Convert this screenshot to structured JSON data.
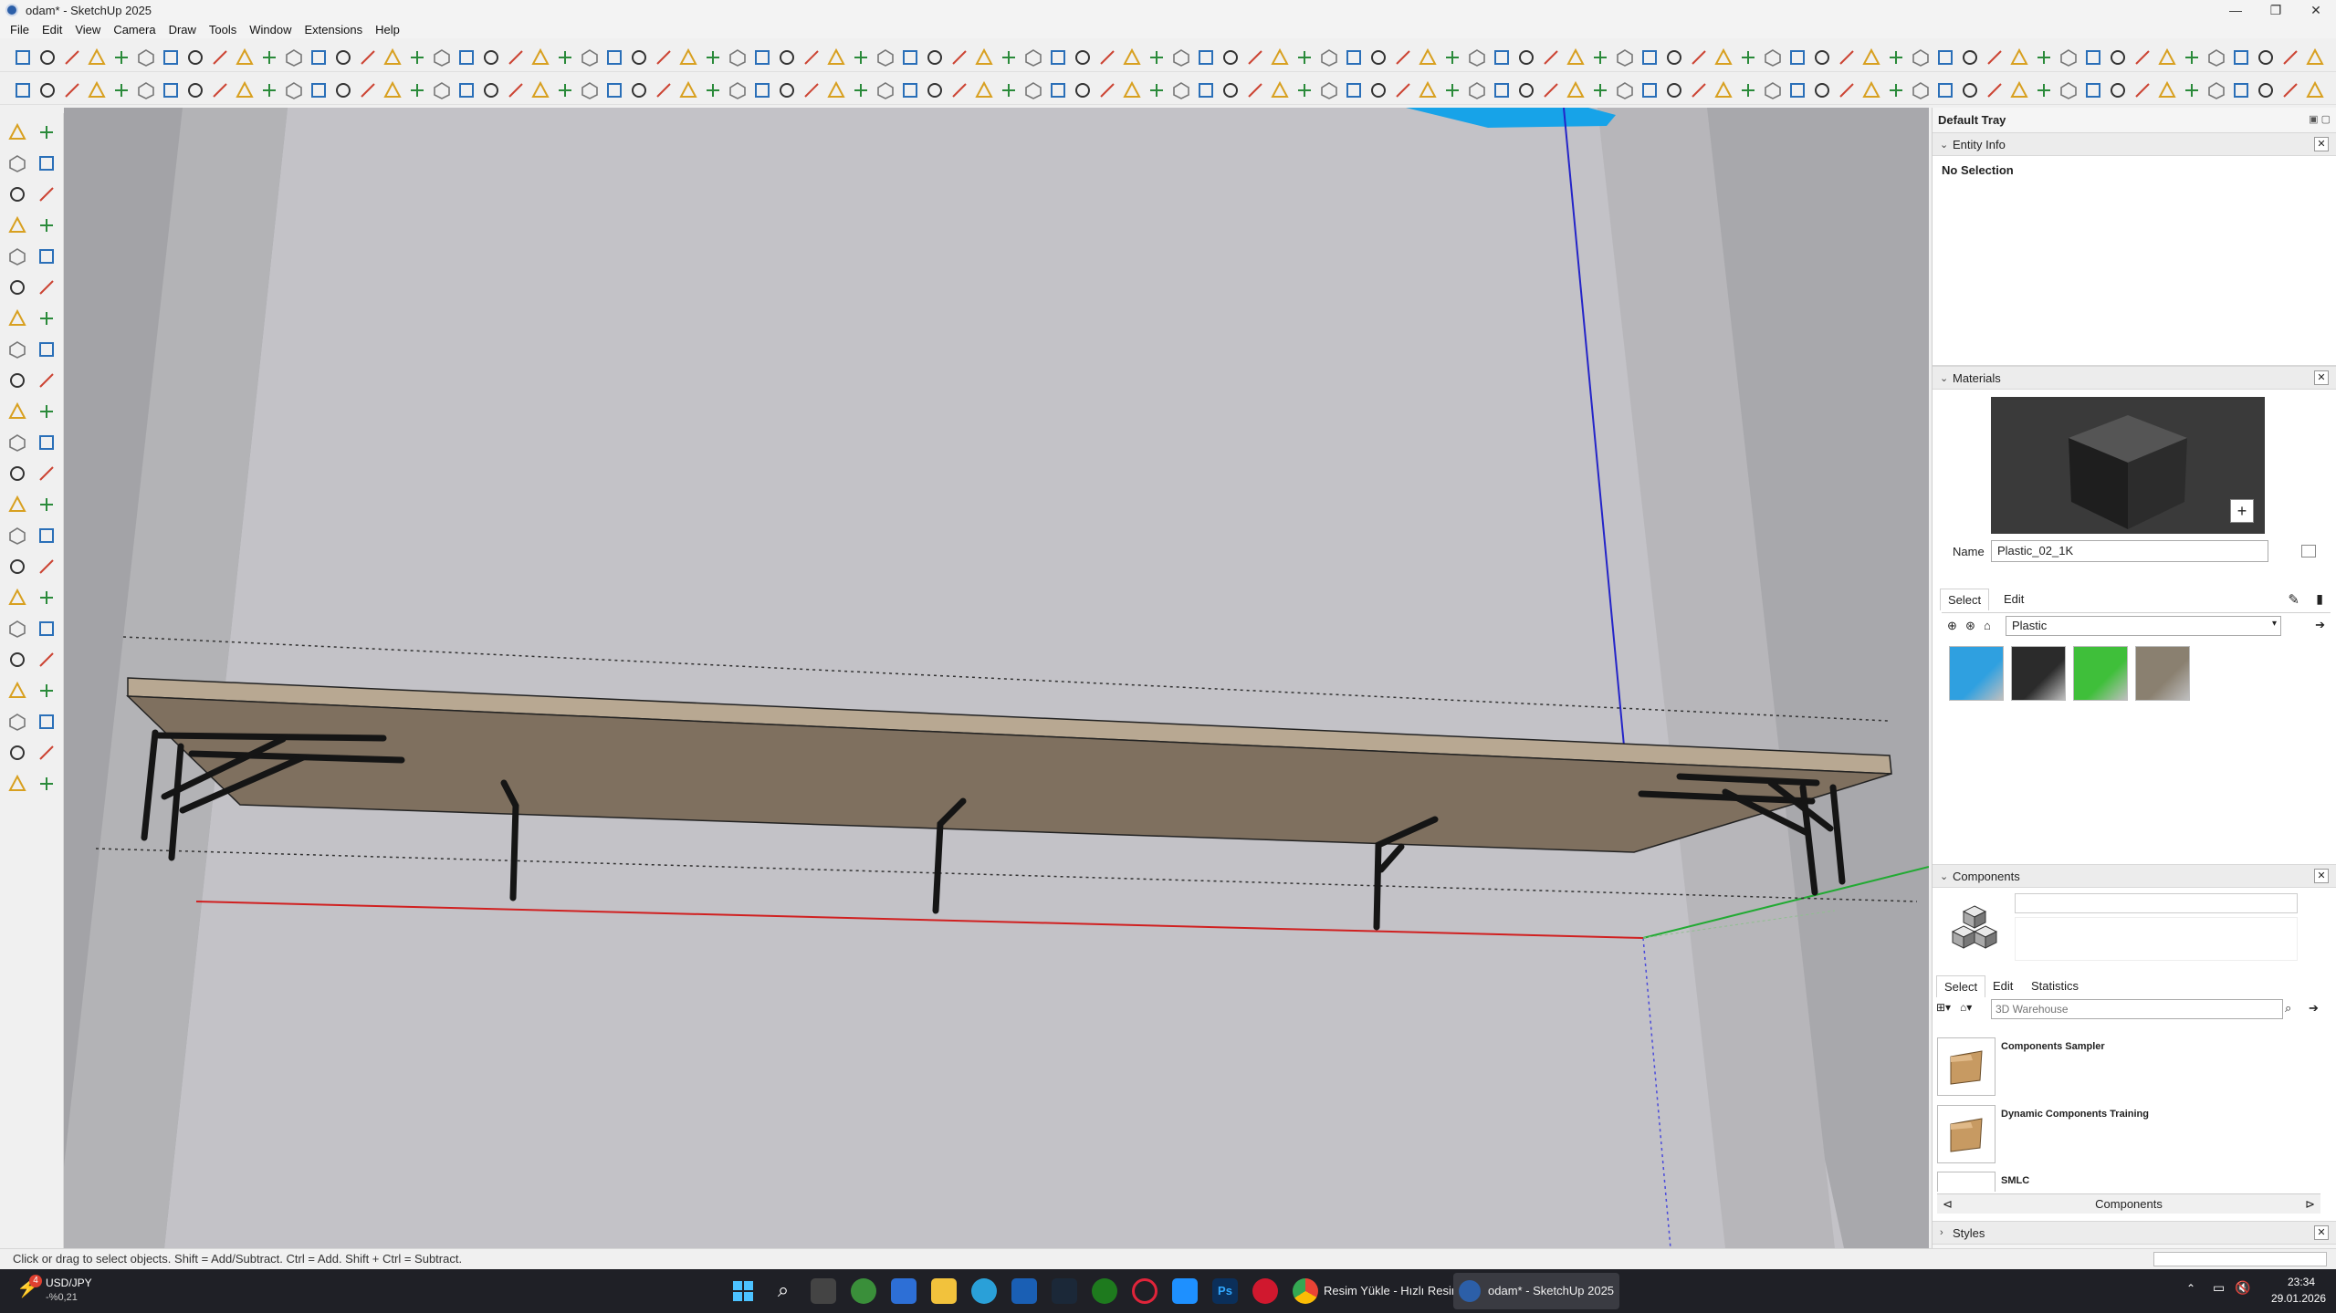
{
  "window": {
    "title": "odam* - SketchUp 2025",
    "minimize": "—",
    "maximize": "❐",
    "close": "✕"
  },
  "menu": [
    "File",
    "Edit",
    "View",
    "Camera",
    "Draw",
    "Tools",
    "Window",
    "Extensions",
    "Help"
  ],
  "toolbar_icons": [
    "new-icon",
    "settings-icon",
    "close-icon",
    "paint-icon",
    "eraser-icon",
    "push-pull-icon",
    "rotate-icon",
    "move-icon",
    "orbit-icon",
    "pan-icon",
    "zoom-icon",
    "zoom-extents-icon",
    "section-icon",
    "component-icon",
    "group-icon",
    "layer-icon",
    "style-icon",
    "shadow-icon",
    "fog-icon",
    "xray-icon",
    "line-icon",
    "arc-icon",
    "rectangle-icon",
    "circle-icon",
    "polygon-icon",
    "text-icon",
    "dimension-icon",
    "protractor-icon",
    "axes-icon",
    "3d-text-icon"
  ],
  "tray": {
    "title": "Default Tray",
    "entity_info": {
      "heading": "Entity Info",
      "selection": "No Selection"
    },
    "materials": {
      "heading": "Materials",
      "name_label": "Name",
      "name_value": "Plastic_02_1K",
      "tab_select": "Select",
      "tab_edit": "Edit",
      "library": "Plastic",
      "swatch_colors": [
        "#2fa0e0",
        "#2b2b2b",
        "#3fbf3a",
        "#8a8070"
      ]
    },
    "components": {
      "heading": "Components",
      "tab_select": "Select",
      "tab_edit": "Edit",
      "tab_statistics": "Statistics",
      "search_placeholder": "3D Warehouse",
      "items": [
        "Components Sampler",
        "Dynamic Components Training",
        "SMLC"
      ],
      "footer": "Components"
    },
    "styles": {
      "heading": "Styles"
    }
  },
  "status": {
    "hint": "Click or drag to select objects. Shift = Add/Subtract. Ctrl = Add. Shift + Ctrl = Subtract."
  },
  "taskbar": {
    "ticker_symbol": "USD/JPY",
    "ticker_change": "-%0,21",
    "ticker_badge": "4",
    "chrome_label": "Resim Yükle - Hızlı Resir",
    "sketchup_label": "odam* - SketchUp 2025",
    "time": "23:34",
    "date": "29.01.2026"
  }
}
